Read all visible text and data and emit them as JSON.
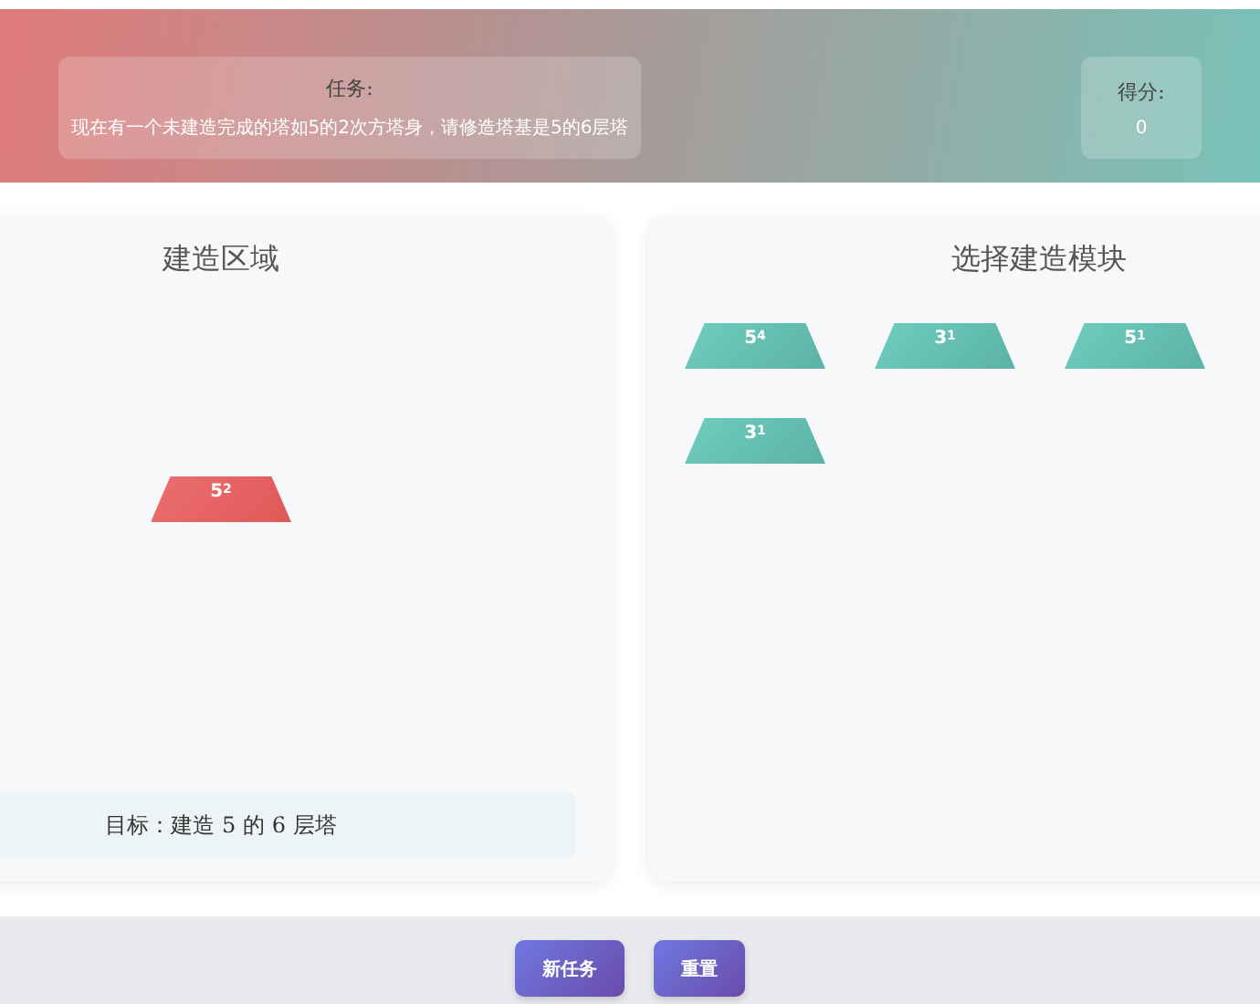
{
  "task": {
    "label": "任务:",
    "text": "现在有一个未建造完成的塔如5的2次方塔身，请修造塔基是5的6层塔"
  },
  "score": {
    "label": "得分:",
    "value": "0"
  },
  "build_area": {
    "title": "建造区域",
    "blocks": [
      {
        "label": "5$^{2}$"
      }
    ],
    "goal": "目标：建造 5 的 6 层塔"
  },
  "module_picker": {
    "title": "选择建造模块",
    "blocks": [
      {
        "label": "5$^{4}$"
      },
      {
        "label": "3$^{1}$"
      },
      {
        "label": "5$^{1}$"
      },
      {
        "label": "3$^{1}$"
      }
    ]
  },
  "buttons": [
    {
      "label": "新任务"
    },
    {
      "label": "重置"
    }
  ]
}
